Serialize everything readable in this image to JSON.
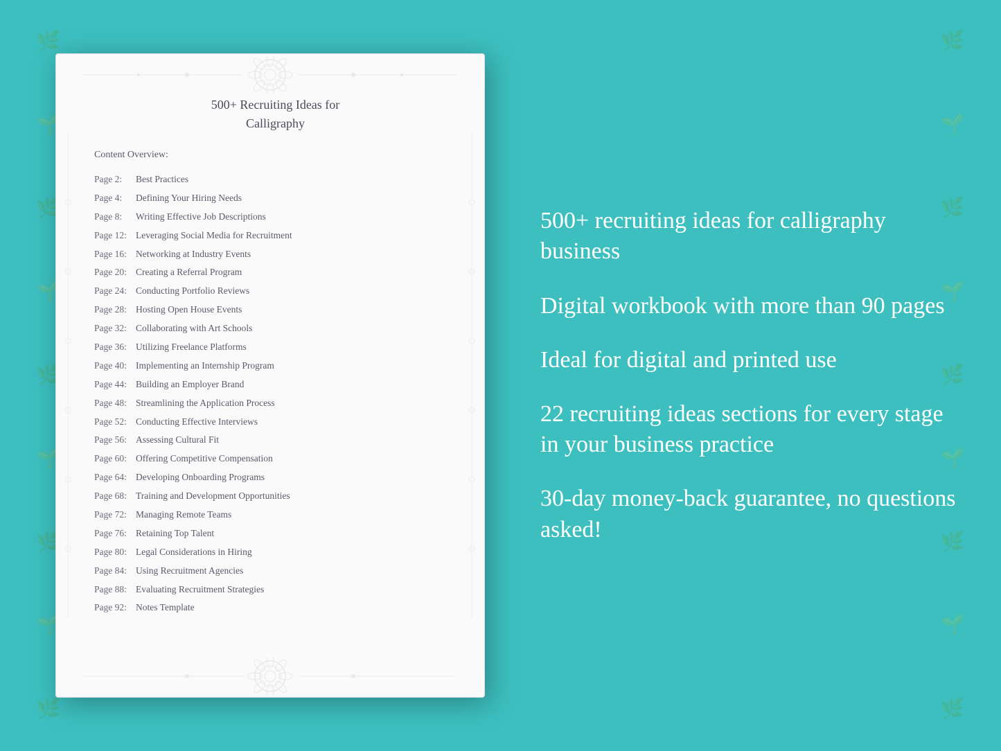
{
  "background": {
    "color": "#3dbfbf"
  },
  "document": {
    "title_line1": "500+ Recruiting Ideas for",
    "title_line2": "Calligraphy",
    "section_label": "Content Overview:",
    "toc_items": [
      {
        "page": "Page  2:",
        "title": "Best Practices"
      },
      {
        "page": "Page  4:",
        "title": "Defining Your Hiring Needs"
      },
      {
        "page": "Page  8:",
        "title": "Writing Effective Job Descriptions"
      },
      {
        "page": "Page 12:",
        "title": "Leveraging Social Media for Recruitment"
      },
      {
        "page": "Page 16:",
        "title": "Networking at Industry Events"
      },
      {
        "page": "Page 20:",
        "title": "Creating a Referral Program"
      },
      {
        "page": "Page 24:",
        "title": "Conducting Portfolio Reviews"
      },
      {
        "page": "Page 28:",
        "title": "Hosting Open House Events"
      },
      {
        "page": "Page 32:",
        "title": "Collaborating with Art Schools"
      },
      {
        "page": "Page 36:",
        "title": "Utilizing Freelance Platforms"
      },
      {
        "page": "Page 40:",
        "title": "Implementing an Internship Program"
      },
      {
        "page": "Page 44:",
        "title": "Building an Employer Brand"
      },
      {
        "page": "Page 48:",
        "title": "Streamlining the Application Process"
      },
      {
        "page": "Page 52:",
        "title": "Conducting Effective Interviews"
      },
      {
        "page": "Page 56:",
        "title": "Assessing Cultural Fit"
      },
      {
        "page": "Page 60:",
        "title": "Offering Competitive Compensation"
      },
      {
        "page": "Page 64:",
        "title": "Developing Onboarding Programs"
      },
      {
        "page": "Page 68:",
        "title": "Training and Development Opportunities"
      },
      {
        "page": "Page 72:",
        "title": "Managing Remote Teams"
      },
      {
        "page": "Page 76:",
        "title": "Retaining Top Talent"
      },
      {
        "page": "Page 80:",
        "title": "Legal Considerations in Hiring"
      },
      {
        "page": "Page 84:",
        "title": "Using Recruitment Agencies"
      },
      {
        "page": "Page 88:",
        "title": "Evaluating Recruitment Strategies"
      },
      {
        "page": "Page 92:",
        "title": "Notes Template"
      }
    ]
  },
  "features": [
    {
      "id": "feature-1",
      "text": "500+ recruiting ideas for calligraphy business"
    },
    {
      "id": "feature-2",
      "text": "Digital workbook with more than 90 pages"
    },
    {
      "id": "feature-3",
      "text": "Ideal for digital and printed use"
    },
    {
      "id": "feature-4",
      "text": "22 recruiting ideas sections for every stage in your business practice"
    },
    {
      "id": "feature-5",
      "text": "30-day money-back guarantee, no questions asked!"
    }
  ]
}
